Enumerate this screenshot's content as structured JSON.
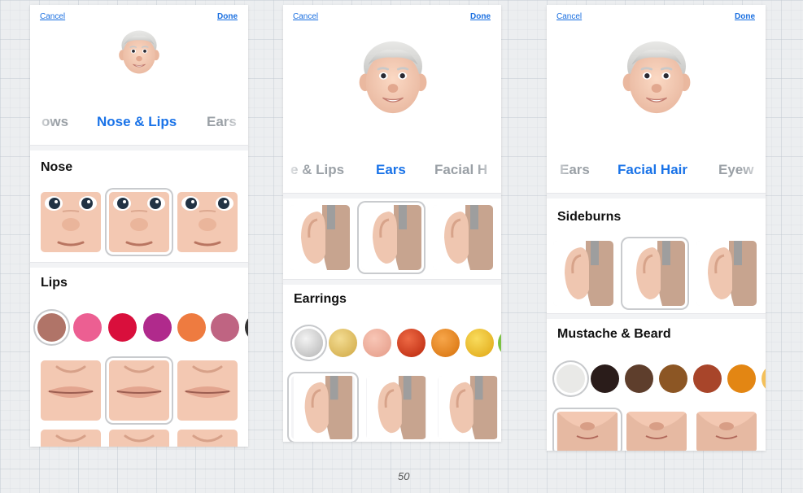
{
  "screens": [
    {
      "cancel": "Cancel",
      "done": "Done",
      "tabs": [
        "ows",
        "Nose & Lips",
        "Ears"
      ],
      "active_tab": "Nose & Lips",
      "sections": [
        "Nose",
        "Lips"
      ],
      "lip_colors": [
        "#b07468",
        "#ec5f92",
        "#d90f3c",
        "#b02a8c",
        "#ee7b40",
        "#bf6482"
      ]
    },
    {
      "cancel": "Cancel",
      "done": "Done",
      "tabs": [
        "e & Lips",
        "Ears",
        "Facial H"
      ],
      "active_tab": "Ears",
      "sections": [
        "Earrings"
      ],
      "earring_colors": [
        "#c9c9c9",
        "#e1bd5c",
        "#eeaa98",
        "#d63a16",
        "#ec8514",
        "#eebd20"
      ]
    },
    {
      "cancel": "Cancel",
      "done": "Done",
      "tabs": [
        "Ears",
        "Facial Hair",
        "Eyew"
      ],
      "active_tab": "Facial Hair",
      "sections": [
        "Sideburns",
        "Mustache & Beard"
      ],
      "beard_colors": [
        "#e9e9e7",
        "#2a1c1a",
        "#5e3e2c",
        "#8c5624",
        "#a8452a",
        "#e38613"
      ]
    }
  ],
  "page_number": "50"
}
